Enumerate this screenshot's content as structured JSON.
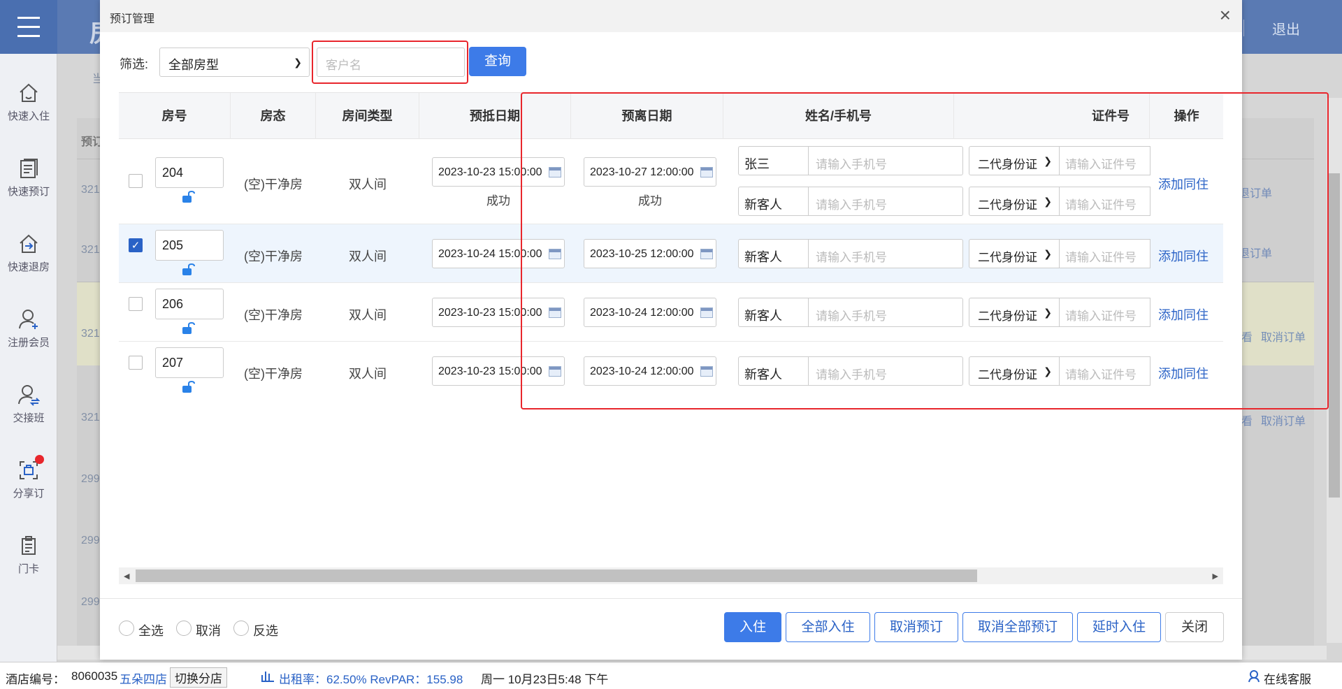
{
  "app": {
    "title_partial": "房",
    "logout": "退出",
    "sidebar": [
      {
        "label": "快速入住",
        "icon": "home-icon"
      },
      {
        "label": "快速预订",
        "icon": "booking-list-icon"
      },
      {
        "label": "快速退房",
        "icon": "checkout-icon"
      },
      {
        "label": "注册会员",
        "icon": "add-member-icon"
      },
      {
        "label": "交接班",
        "icon": "shift-handover-icon"
      },
      {
        "label": "分享订",
        "icon": "share-booking-icon"
      },
      {
        "label": "门卡",
        "icon": "door-card-icon"
      }
    ],
    "background": {
      "col_partial": "预订",
      "rows": [
        "321",
        "321",
        "321",
        "321",
        "299",
        "299",
        "299"
      ],
      "links": [
        "退订单",
        "退订单",
        "取消订单",
        "取消订单"
      ],
      "short_links": [
        "看",
        "看"
      ],
      "left_partial": "当"
    },
    "statusbar": {
      "hotel_no_label": "酒店编号：",
      "hotel_no": "8060035",
      "branch": "五朵四店",
      "switch": "切换分店",
      "occupancy": "出租率：62.50% RevPAR：155.98",
      "datetime": "周一 10月23日5:48 下午",
      "service": "在线客服"
    }
  },
  "modal": {
    "title": "预订管理",
    "close": "×",
    "filter": {
      "label": "筛选:",
      "room_type": "全部房型",
      "customer_placeholder": "客户名",
      "query": "查询"
    },
    "columns": [
      "房号",
      "房态",
      "房间类型",
      "预抵日期",
      "预离日期",
      "姓名/手机号",
      "证件号",
      "操作"
    ],
    "rows": [
      {
        "room": "204",
        "checked": false,
        "status": "(空)干净房",
        "type": "双人间",
        "arrive": "2023-10-23 15:00:00",
        "arrive_status": "成功",
        "leave": "2023-10-27 12:00:00",
        "leave_status": "成功",
        "guests": [
          {
            "name": "张三",
            "phone_ph": "请输入手机号",
            "id_type": "二代身份证",
            "id_ph": "请输入证件号"
          },
          {
            "name": "新客人",
            "phone_ph": "请输入手机号",
            "id_type": "二代身份证",
            "id_ph": "请输入证件号"
          }
        ],
        "action": "添加同住"
      },
      {
        "room": "205",
        "checked": true,
        "status": "(空)干净房",
        "type": "双人间",
        "arrive": "2023-10-24 15:00:00",
        "leave": "2023-10-25 12:00:00",
        "guests": [
          {
            "name": "新客人",
            "phone_ph": "请输入手机号",
            "id_type": "二代身份证",
            "id_ph": "请输入证件号"
          }
        ],
        "action": "添加同住"
      },
      {
        "room": "206",
        "checked": false,
        "status": "(空)干净房",
        "type": "双人间",
        "arrive": "2023-10-23 15:00:00",
        "leave": "2023-10-24 12:00:00",
        "guests": [
          {
            "name": "新客人",
            "phone_ph": "请输入手机号",
            "id_type": "二代身份证",
            "id_ph": "请输入证件号"
          }
        ],
        "action": "添加同住"
      },
      {
        "room": "207",
        "checked": false,
        "status": "(空)干净房",
        "type": "双人间",
        "arrive": "2023-10-23 15:00:00",
        "leave": "2023-10-24 12:00:00",
        "guests": [
          {
            "name": "新客人",
            "phone_ph": "请输入手机号",
            "id_type": "二代身份证",
            "id_ph": "请输入证件号"
          }
        ],
        "action": "添加同住"
      }
    ],
    "footer": {
      "radios": [
        "全选",
        "取消",
        "反选"
      ],
      "buttons": [
        "入住",
        "全部入住",
        "取消预订",
        "取消全部预订",
        "延时入住",
        "关闭"
      ]
    }
  },
  "colors": {
    "accent": "#3d7be8",
    "link": "#2a62c6",
    "highlight": "#e8262c"
  }
}
